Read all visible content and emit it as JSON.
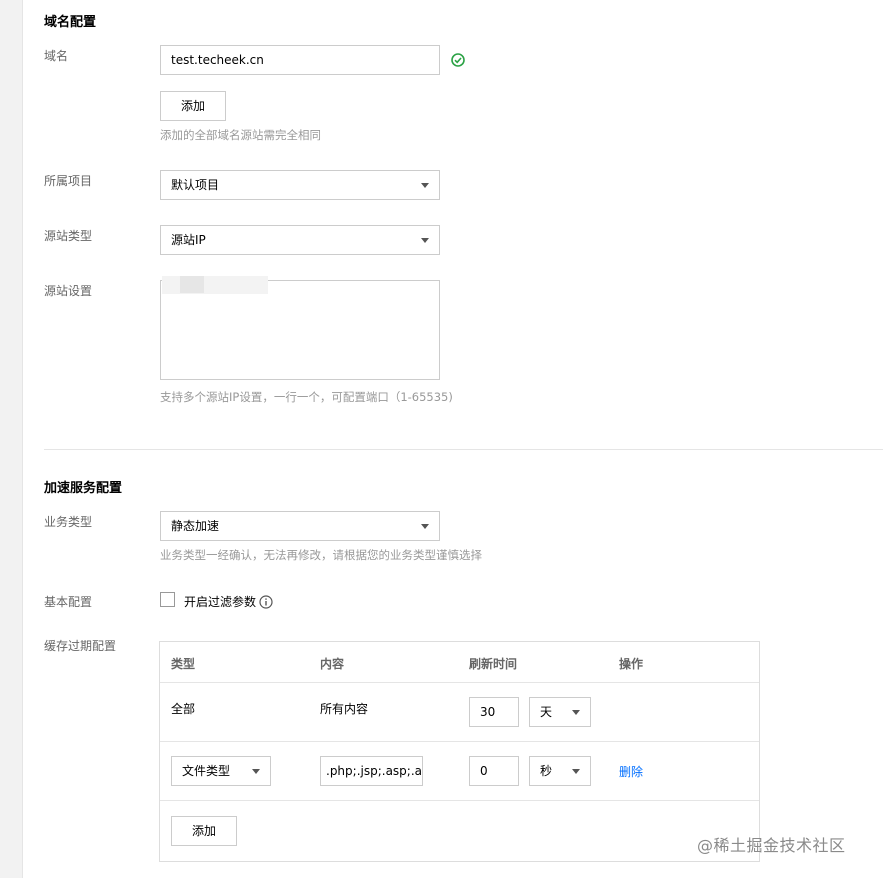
{
  "domain_section": {
    "title": "域名配置",
    "domain_label": "域名",
    "domain_value": "test.techeek.cn",
    "add_button": "添加",
    "add_hint": "添加的全部域名源站需完全相同",
    "project_label": "所属项目",
    "project_value": "默认项目",
    "origin_type_label": "源站类型",
    "origin_type_value": "源站IP",
    "origin_settings_label": "源站设置",
    "origin_hint": "支持多个源站IP设置，一行一个，可配置端口（1-65535)"
  },
  "acceleration_section": {
    "title": "加速服务配置",
    "business_type_label": "业务类型",
    "business_type_value": "静态加速",
    "business_type_hint": "业务类型一经确认，无法再修改，请根据您的业务类型谨慎选择",
    "basic_config_label": "基本配置",
    "filter_params_label": "开启过滤参数",
    "cache_label": "缓存过期配置"
  },
  "cache_table": {
    "headers": [
      "类型",
      "内容",
      "刷新时间",
      "操作"
    ],
    "rows": [
      {
        "type": "全部",
        "content": "所有内容",
        "time": "30",
        "unit": "天",
        "action": ""
      },
      {
        "type": "文件类型",
        "content": ".php;.jsp;.asp;.a",
        "time": "0",
        "unit": "秒",
        "action": "删除"
      }
    ],
    "add_button": "添加"
  },
  "watermark": "@稀土掘金技术社区",
  "colors": {
    "link": "#006eff",
    "success": "#2ba245"
  }
}
